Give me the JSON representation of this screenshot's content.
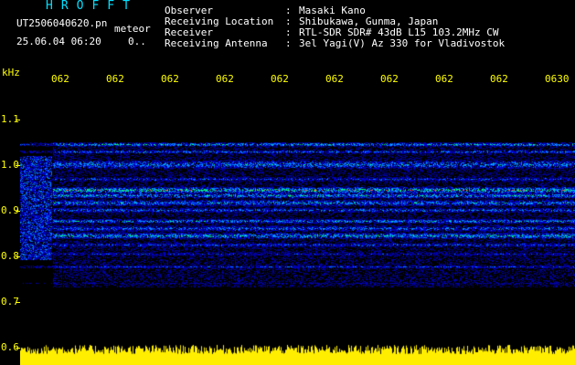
{
  "header": {
    "title": "HROFFT",
    "filename": "UT2506040620.pn",
    "datetime": "25.06.04 06:20",
    "mode": "meteor",
    "count": "0.."
  },
  "station": [
    {
      "label": "Observer",
      "value": "Masaki Kano"
    },
    {
      "label": "Receiving Location",
      "value": "Shibukawa, Gunma, Japan"
    },
    {
      "label": "Receiver",
      "value": "RTL-SDR SDR# 43dB L15 103.2MHz CW"
    },
    {
      "label": "Receiving Antenna",
      "value": "3el Yagi(V) Az 330 for Vladivostok"
    }
  ],
  "axis": {
    "unit": "kHz",
    "y_ticks": [
      "1.1",
      "1.0",
      "0.9",
      "0.8",
      "0.7",
      "0.6"
    ],
    "x_ticks": [
      "062",
      "062",
      "062",
      "062",
      "062",
      "062",
      "062",
      "062",
      "062",
      "0630"
    ]
  },
  "colors": {
    "background": "#000000",
    "title": "#00e0ff",
    "axis": "#ffff00",
    "signal_low": "#0030ff",
    "signal_mid": "#00ff80",
    "signal_high": "#ff3030",
    "noise_floor": "#ffee00"
  }
}
